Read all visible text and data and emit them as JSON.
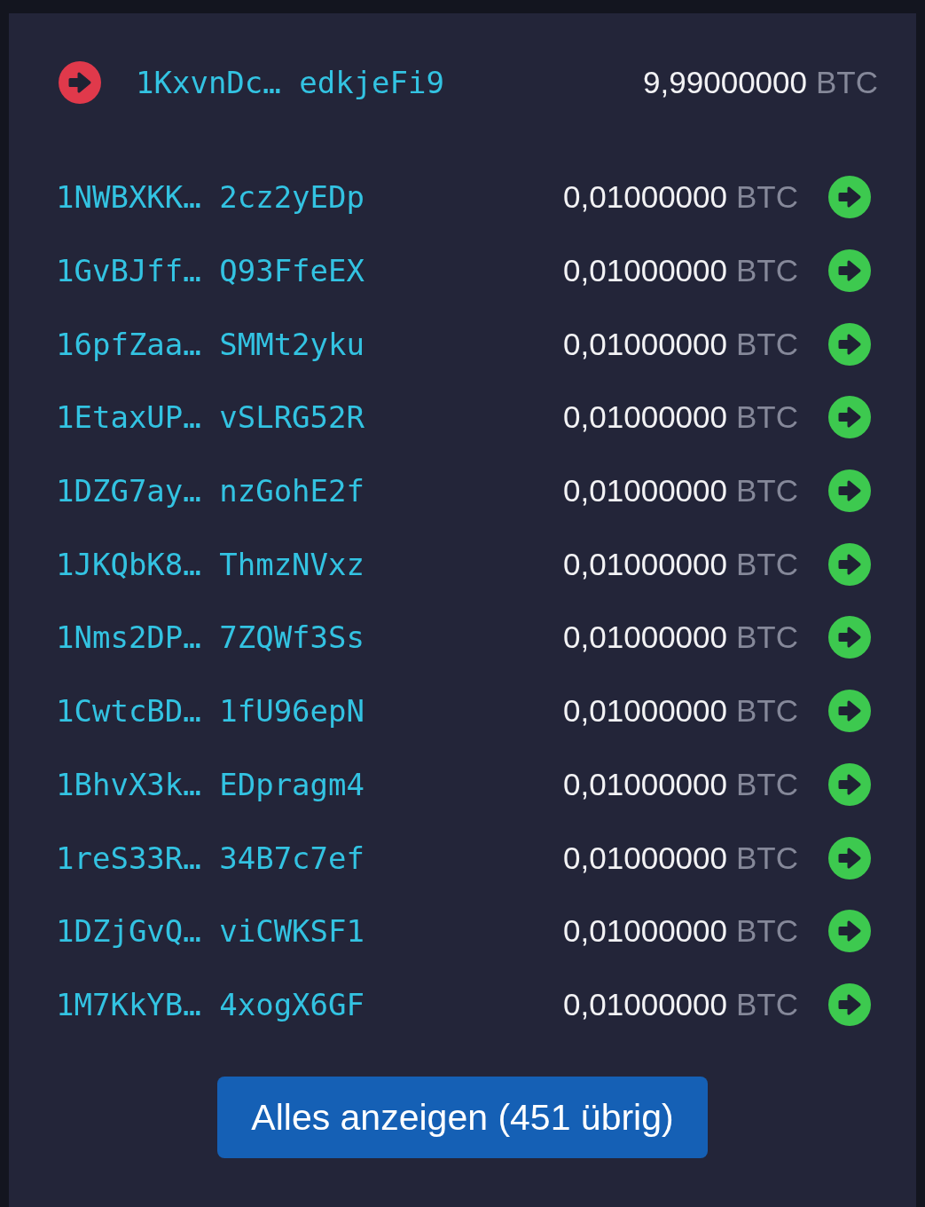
{
  "inputs": [
    {
      "address": "1KxvnDc… edkjeFi9",
      "amount": "9,99000000",
      "unit": "BTC"
    }
  ],
  "outputs": [
    {
      "address": "1NWBXKK… 2cz2yEDp",
      "amount": "0,01000000",
      "unit": "BTC"
    },
    {
      "address": "1GvBJff… Q93FfeEX",
      "amount": "0,01000000",
      "unit": "BTC"
    },
    {
      "address": "16pfZaa… SMMt2yku",
      "amount": "0,01000000",
      "unit": "BTC"
    },
    {
      "address": "1EtaxUP… vSLRG52R",
      "amount": "0,01000000",
      "unit": "BTC"
    },
    {
      "address": "1DZG7ay… nzGohE2f",
      "amount": "0,01000000",
      "unit": "BTC"
    },
    {
      "address": "1JKQbK8… ThmzNVxz",
      "amount": "0,01000000",
      "unit": "BTC"
    },
    {
      "address": "1Nms2DP… 7ZQWf3Ss",
      "amount": "0,01000000",
      "unit": "BTC"
    },
    {
      "address": "1CwtcBD… 1fU96epN",
      "amount": "0,01000000",
      "unit": "BTC"
    },
    {
      "address": "1BhvX3k… EDpragm4",
      "amount": "0,01000000",
      "unit": "BTC"
    },
    {
      "address": "1reS33R… 34B7c7ef",
      "amount": "0,01000000",
      "unit": "BTC"
    },
    {
      "address": "1DZjGvQ… viCWKSF1",
      "amount": "0,01000000",
      "unit": "BTC"
    },
    {
      "address": "1M7KkYB… 4xogX6GF",
      "amount": "0,01000000",
      "unit": "BTC"
    }
  ],
  "show_all_button": {
    "label": "Alles anzeigen (451 übrig)"
  }
}
